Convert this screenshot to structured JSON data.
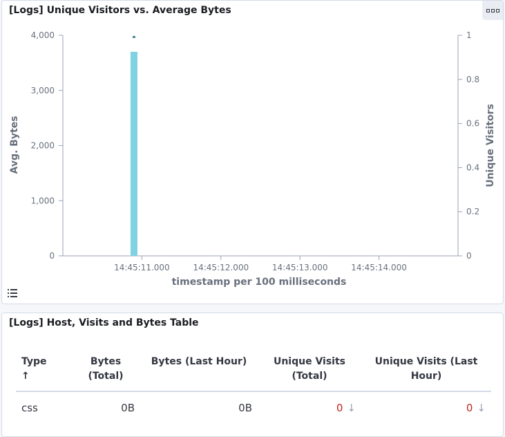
{
  "panel1": {
    "title": "[Logs] Unique Visitors vs. Average Bytes"
  },
  "panel2": {
    "title": "[Logs] Host, Visits and Bytes Table",
    "columns": [
      "Type",
      "Bytes (Total)",
      "Bytes (Last Hour)",
      "Unique Visits (Total)",
      "Unique Visits (Last Hour)"
    ],
    "sort_indicator": "↑",
    "rows": [
      {
        "type": "css",
        "bytes_total": "0B",
        "bytes_last_hour": "0B",
        "visits_total": "0",
        "visits_last_hour": "0",
        "trend_icon": "↓"
      }
    ]
  },
  "colors": {
    "bar": "#7fd2e3",
    "marker": "#3f8a9a",
    "axis": "#98a2b3",
    "label": "#69707d",
    "danger": "#bd271e"
  },
  "chart_data": {
    "type": "bar",
    "xlabel": "timestamp per 100 milliseconds",
    "ylabel": "Avg. Bytes",
    "y2label": "Unique Visitors",
    "x_ticks": [
      "14:45:11.000",
      "14:45:12.000",
      "14:45:13.000",
      "14:45:14.000"
    ],
    "x_range_seconds": [
      10.0,
      15.0
    ],
    "y_ticks": [
      "0",
      "1,000",
      "2,000",
      "3,000",
      "4,000"
    ],
    "ylim": [
      0,
      4000
    ],
    "y2_ticks": [
      "0",
      "0.2",
      "0.4",
      "0.6",
      "0.8",
      "1"
    ],
    "y2lim": [
      0,
      1
    ],
    "series": [
      {
        "name": "Avg. Bytes",
        "axis": "left",
        "kind": "bar",
        "points": [
          {
            "x": "14:45:10.900",
            "x_seconds": 10.9,
            "y": 3700
          }
        ]
      },
      {
        "name": "Unique Visitors",
        "axis": "right",
        "kind": "point",
        "points": [
          {
            "x": "14:45:10.900",
            "x_seconds": 10.9,
            "y": 1
          }
        ]
      }
    ]
  }
}
